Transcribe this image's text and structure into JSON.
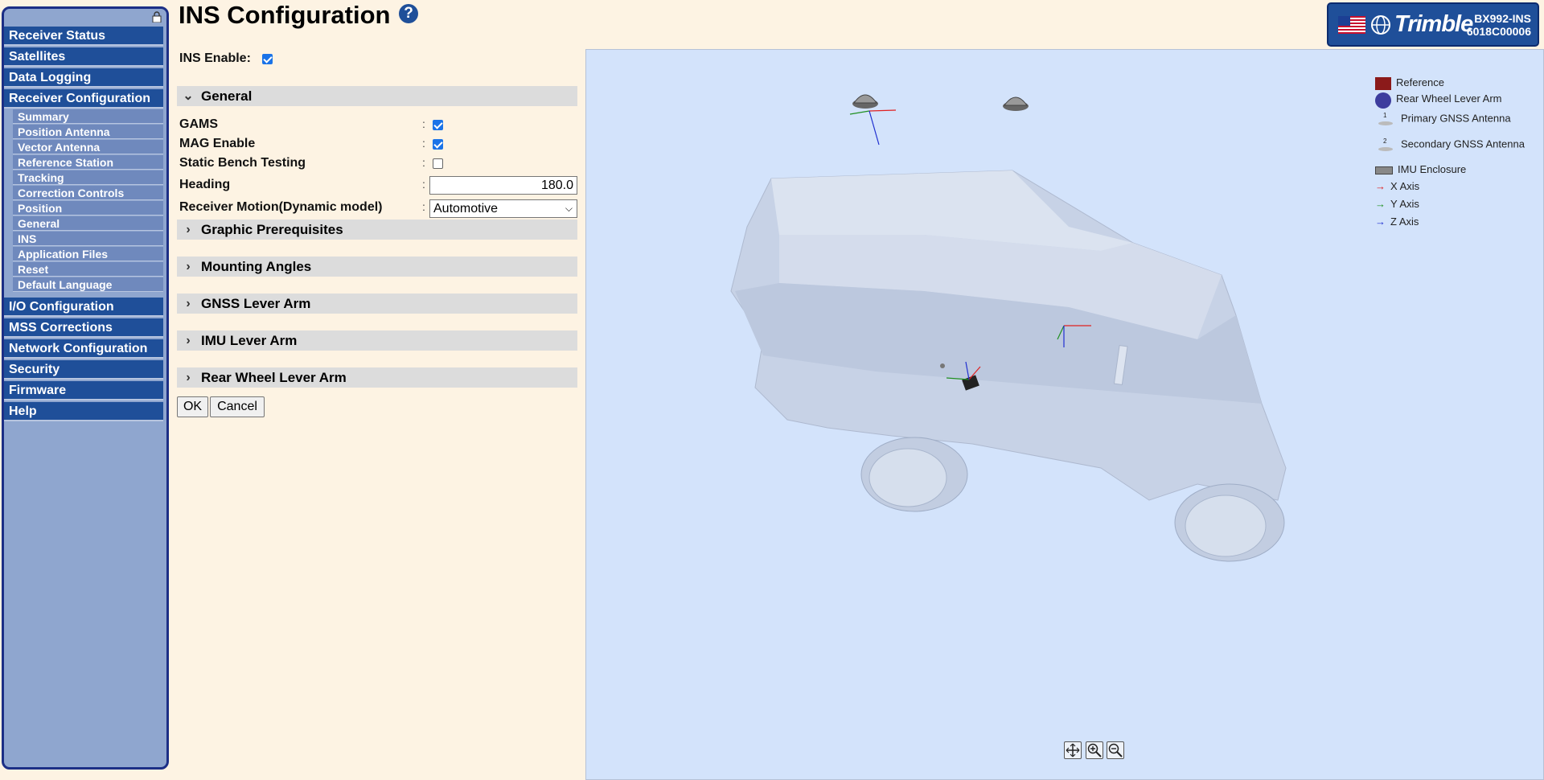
{
  "header": {
    "title": "INS Configuration",
    "help": "?",
    "brand_logo": "Trimble",
    "model_line1": "BX992-INS",
    "model_line2": "6018C00006"
  },
  "sidebar": {
    "top_items": [
      {
        "label": "Receiver Status"
      },
      {
        "label": "Satellites"
      },
      {
        "label": "Data Logging"
      },
      {
        "label": "Receiver Configuration"
      }
    ],
    "sub_items": [
      {
        "label": "Summary"
      },
      {
        "label": "Position Antenna"
      },
      {
        "label": "Vector Antenna"
      },
      {
        "label": "Reference Station"
      },
      {
        "label": "Tracking"
      },
      {
        "label": "Correction Controls"
      },
      {
        "label": "Position"
      },
      {
        "label": "General"
      },
      {
        "label": "INS"
      },
      {
        "label": "Application Files"
      },
      {
        "label": "Reset"
      },
      {
        "label": "Default Language"
      }
    ],
    "bottom_items": [
      {
        "label": "I/O Configuration"
      },
      {
        "label": "MSS Corrections"
      },
      {
        "label": "Network Configuration"
      },
      {
        "label": "Security"
      },
      {
        "label": "Firmware"
      },
      {
        "label": "Help"
      }
    ]
  },
  "form": {
    "ins_enable_label": "INS Enable:",
    "ins_enable_checked": true,
    "general_section": "General",
    "gams_label": "GAMS",
    "gams_checked": true,
    "mag_label": "MAG Enable",
    "mag_checked": true,
    "static_label": "Static Bench Testing",
    "static_checked": false,
    "heading_label": "Heading",
    "heading_value": "180.0",
    "motion_label": "Receiver Motion(Dynamic model)",
    "motion_value": "Automotive",
    "sections": [
      "Graphic Prerequisites",
      "Mounting Angles",
      "GNSS Lever Arm",
      "IMU Lever Arm",
      "Rear Wheel Lever Arm"
    ],
    "ok_label": "OK",
    "cancel_label": "Cancel"
  },
  "legend": {
    "items": [
      {
        "label": "Reference",
        "color": "#8b1a1a"
      },
      {
        "label": "Rear Wheel Lever Arm",
        "color": "#3d3d9e"
      },
      {
        "label": "Primary GNSS Antenna",
        "marker": "1"
      },
      {
        "label": "Secondary GNSS Antenna",
        "marker": "2"
      },
      {
        "label": "IMU Enclosure"
      },
      {
        "label": "X Axis",
        "color": "#e02020"
      },
      {
        "label": "Y Axis",
        "color": "#209020"
      },
      {
        "label": "Z Axis",
        "color": "#2030d0"
      }
    ]
  },
  "viewer_controls": [
    "fit-view-icon",
    "zoom-in-icon",
    "zoom-out-icon"
  ]
}
